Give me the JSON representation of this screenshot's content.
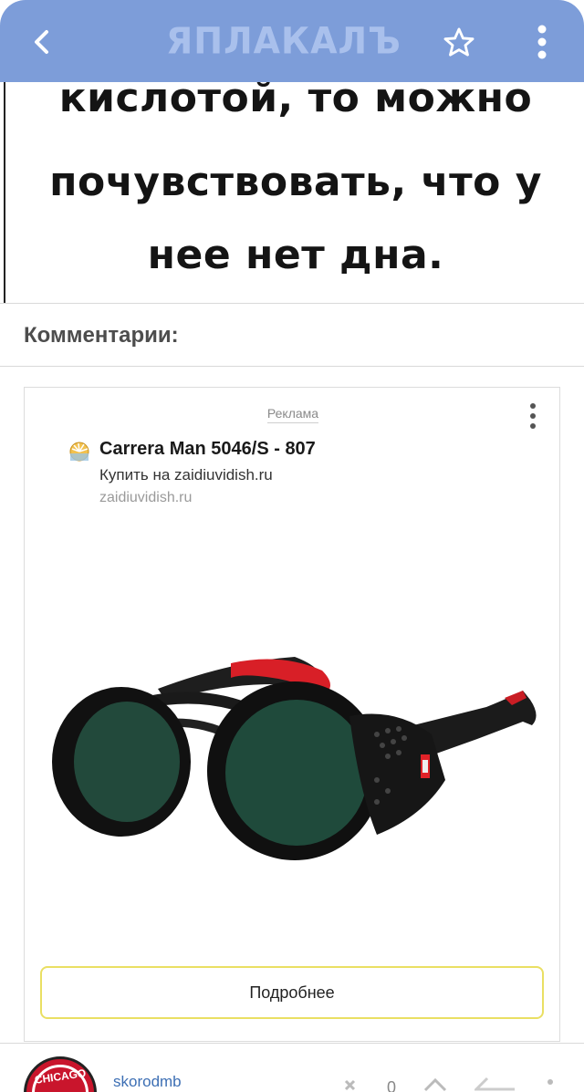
{
  "header": {
    "logo_text": "ЯПЛАКАЛЪ",
    "back_icon": "chevron-left-icon",
    "star_icon": "star-outline-icon",
    "menu_icon": "more-vertical-icon",
    "bg_color": "#7d9dd9"
  },
  "post": {
    "meme_lines": [
      "кислотой, то можно",
      "почувствовать, что у",
      "нее нет дна."
    ]
  },
  "comments": {
    "title": "Комментарии:"
  },
  "ad": {
    "label": "Реклама",
    "title": "Carrera Man 5046/S - 807",
    "subtitle": "Купить на zaidiuvidish.ru",
    "domain": "zaidiuvidish.ru",
    "button": "Подробнее",
    "button_border_color": "#eadf63"
  },
  "comment": {
    "username": "skorodmb",
    "avatar_text": "CHICAGO",
    "rating": "0"
  }
}
